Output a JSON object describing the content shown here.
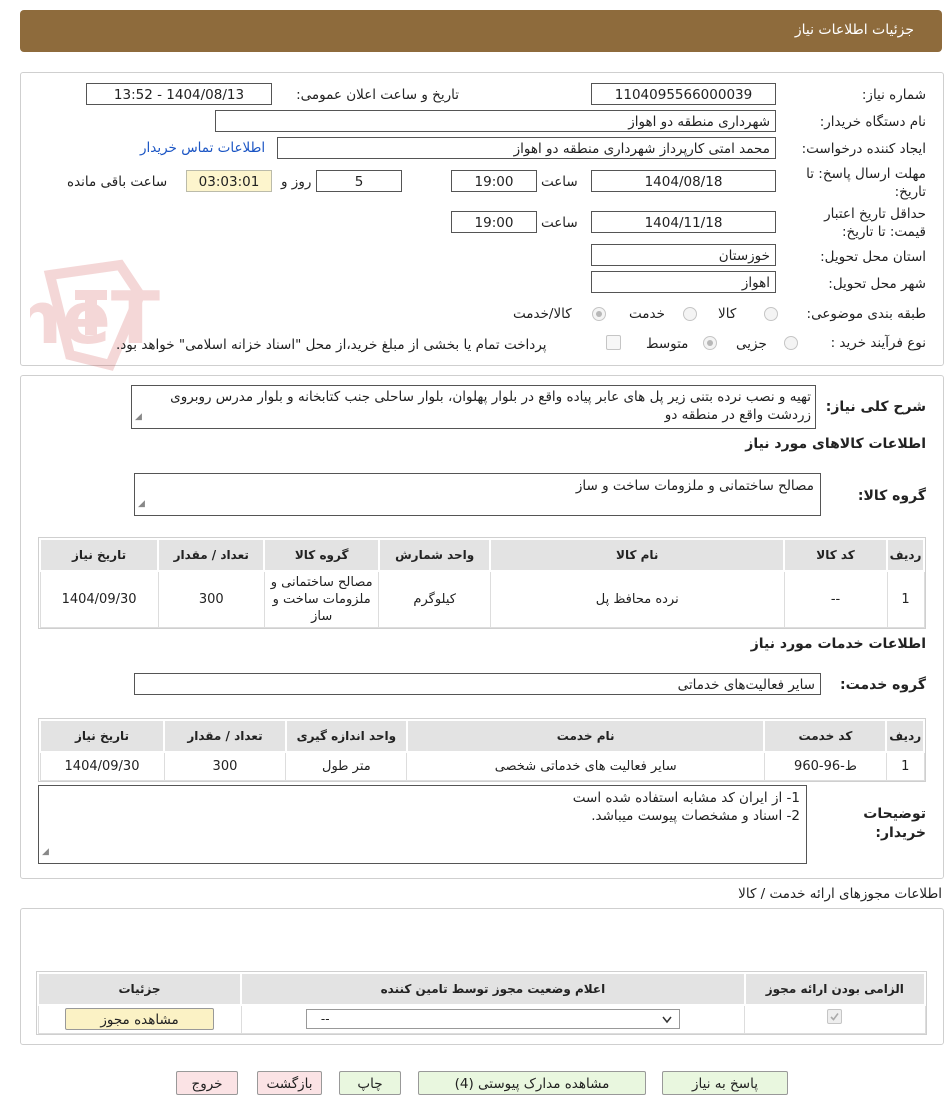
{
  "header": {
    "title": "جزئیات اطلاعات نیاز"
  },
  "watermark": {
    "text": "AriaTender.neT",
    "color": "#c62828"
  },
  "form": {
    "need_number_label": "شماره نیاز:",
    "need_number": "1104095566000039",
    "announce_label": "تاریخ و ساعت اعلان عمومی:",
    "announce_value": "1404/08/13 - 13:52",
    "buyer_org_label": "نام دستگاه خریدار:",
    "buyer_org": "شهرداری منطقه دو اهواز",
    "requester_label": "ایجاد کننده درخواست:",
    "requester": "محمد امتی کارپرداز شهرداری منطقه دو اهواز",
    "contact_link": "اطلاعات تماس خریدار",
    "deadline_label_1": "مهلت ارسال پاسخ: تا",
    "deadline_label_2": "تاریخ:",
    "deadline_date": "1404/08/18",
    "time_label": "ساعت",
    "deadline_time": "19:00",
    "days_value": "5",
    "days_label": "روز و",
    "remaining_time": "03:03:01",
    "remaining_label": "ساعت باقی مانده",
    "validity_label_1": "حداقل تاریخ اعتبار",
    "validity_label_2": "قیمت: تا تاریخ:",
    "validity_date": "1404/11/18",
    "validity_time": "19:00",
    "province_label": "استان محل تحویل:",
    "province": "خوزستان",
    "city_label": "شهر محل تحویل:",
    "city": "اهواز",
    "category_label": "طبقه بندی موضوعی:",
    "category_options": [
      "کالا",
      "خدمت",
      "کالا/خدمت"
    ],
    "process_label": "نوع فرآیند خرید :",
    "process_options": [
      "جزیی",
      "متوسط"
    ],
    "payment_note": "پرداخت تمام یا بخشی از مبلغ خرید،از محل \"اسناد خزانه اسلامی\" خواهد بود."
  },
  "summary": {
    "label": "شرح کلی نیاز:",
    "text": "تهیه و نصب نرده بتنی زیر پل های عابر پیاده واقع در بلوار پهلوان، بلوار ساحلی جنب کتابخانه و بلوار مدرس روبروی زردشت واقع در منطقه دو"
  },
  "goods": {
    "section_title": "اطلاعات کالاهای مورد نیاز",
    "group_label": "گروه کالا:",
    "group_value": "مصالح ساختمانی و ملزومات ساخت و ساز",
    "columns": [
      "ردیف",
      "کد کالا",
      "نام کالا",
      "واحد شمارش",
      "گروه کالا",
      "تعداد / مقدار",
      "تاریخ نیاز"
    ],
    "rows": [
      [
        "1",
        "--",
        "نرده محافظ پل",
        "کیلوگرم",
        "مصالح ساختمانی و ملزومات ساخت و ساز",
        "300",
        "1404/09/30"
      ]
    ]
  },
  "services": {
    "section_title": "اطلاعات خدمات مورد نیاز",
    "group_label": "گروه خدمت:",
    "group_value": "سایر فعالیت‌های خدماتی",
    "columns": [
      "ردیف",
      "کد خدمت",
      "نام خدمت",
      "واحد اندازه گیری",
      "تعداد / مقدار",
      "تاریخ نیاز"
    ],
    "rows": [
      [
        "1",
        "ط-96-960",
        "سایر فعالیت های خدماتی شخصی",
        "متر طول",
        "300",
        "1404/09/30"
      ]
    ]
  },
  "buyer_notes": {
    "label_1": "توضیحات",
    "label_2": "خریدار:",
    "line_1": "1- از ایران کد مشابه استفاده شده است",
    "line_2": "2- اسناد و مشخصات پیوست میباشد."
  },
  "permits": {
    "section_title": "اطلاعات مجوزهای ارائه خدمت / کالا",
    "columns": [
      "الزامی بودن ارائه مجوز",
      "اعلام وضعیت مجوز توسط تامین کننده",
      "جزئیات"
    ],
    "select_value": "--",
    "view_button": "مشاهده مجوز"
  },
  "buttons": {
    "reply": "پاسخ به نیاز",
    "attachments": "مشاهده مدارک پیوستی (4)",
    "print": "چاپ",
    "back": "بازگشت",
    "exit": "خروج"
  }
}
